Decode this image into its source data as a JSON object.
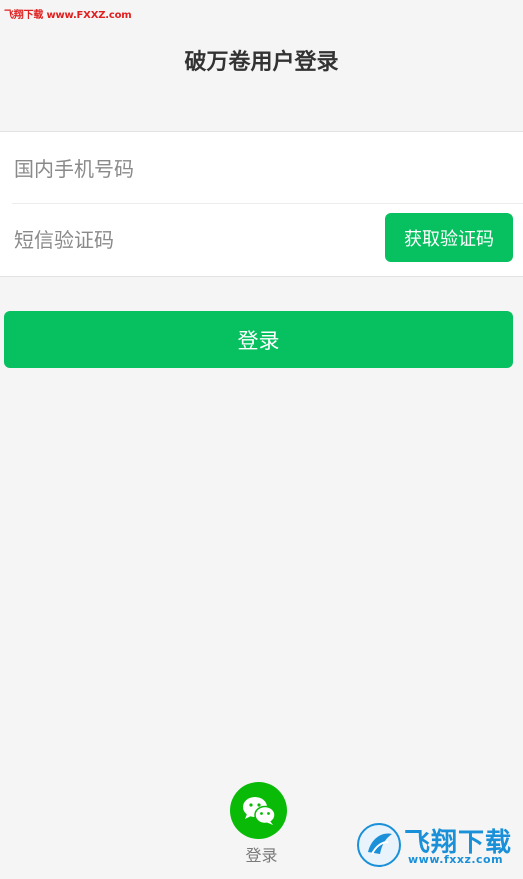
{
  "watermark": {
    "top_text": "飞翔下载 www.FXXZ.com"
  },
  "header": {
    "title": "破万卷用户登录"
  },
  "form": {
    "phone_placeholder": "国内手机号码",
    "sms_placeholder": "短信验证码",
    "get_code_label": "获取验证码"
  },
  "login_button": {
    "label": "登录"
  },
  "wechat_login": {
    "icon": "wechat-icon",
    "label": "登录"
  },
  "logo": {
    "text": "飞翔下载",
    "url": "www.fxxz.com"
  },
  "colors": {
    "primary": "#07c160",
    "wechat": "#09bb07",
    "background": "#f5f5f5"
  }
}
